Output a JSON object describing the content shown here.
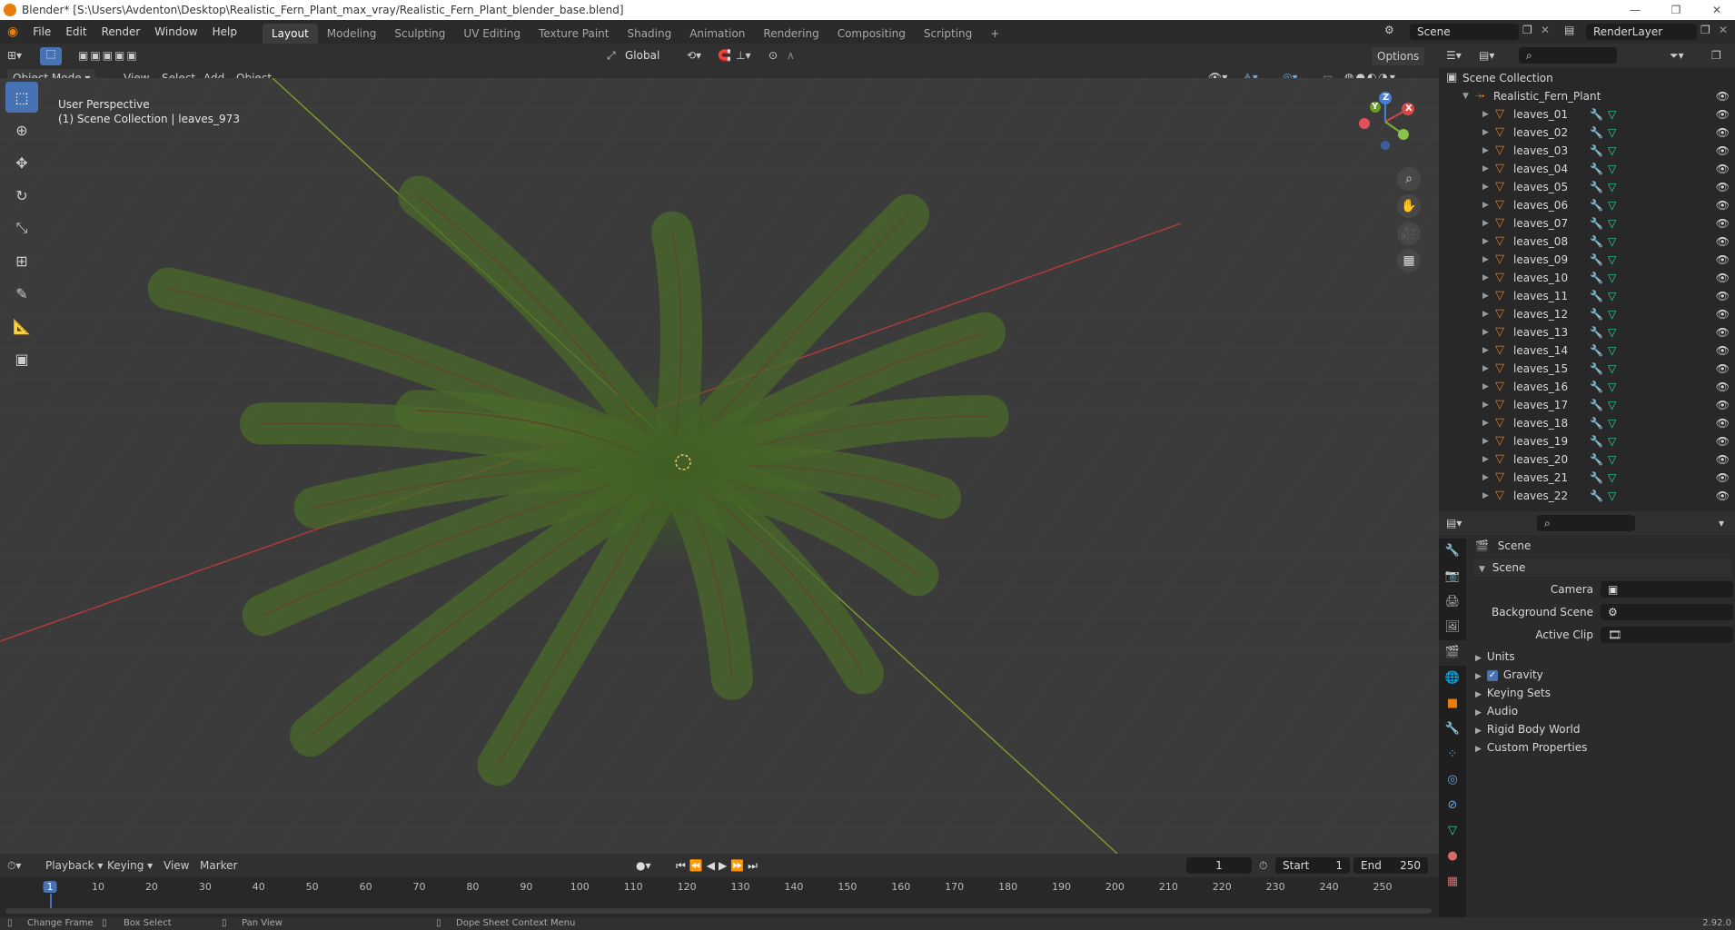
{
  "window": {
    "title": "Blender* [S:\\Users\\Avdenton\\Desktop\\Realistic_Fern_Plant_max_vray/Realistic_Fern_Plant_blender_base.blend]"
  },
  "menus": [
    "File",
    "Edit",
    "Render",
    "Window",
    "Help"
  ],
  "workspaces": [
    "Layout",
    "Modeling",
    "Sculpting",
    "UV Editing",
    "Texture Paint",
    "Shading",
    "Animation",
    "Rendering",
    "Compositing",
    "Scripting"
  ],
  "scene_field": "Scene",
  "render_layer_field": "RenderLayer",
  "viewport": {
    "mode": "Object Mode",
    "menus": [
      "View",
      "Select",
      "Add",
      "Object"
    ],
    "transform": "Global",
    "options": "Options",
    "overlay_line1": "User Perspective",
    "overlay_line2": "(1) Scene Collection | leaves_973",
    "gizmo": {
      "x": "X",
      "y": "Y",
      "z": "Z"
    }
  },
  "outliner": {
    "root": "Scene Collection",
    "collection": "Realistic_Fern_Plant",
    "items": [
      "leaves_01",
      "leaves_02",
      "leaves_03",
      "leaves_04",
      "leaves_05",
      "leaves_06",
      "leaves_07",
      "leaves_08",
      "leaves_09",
      "leaves_10",
      "leaves_11",
      "leaves_12",
      "leaves_13",
      "leaves_14",
      "leaves_15",
      "leaves_16",
      "leaves_17",
      "leaves_18",
      "leaves_19",
      "leaves_20",
      "leaves_21",
      "leaves_22"
    ]
  },
  "properties": {
    "header": "Scene",
    "panel": "Scene",
    "camera_label": "Camera",
    "background_label": "Background Scene",
    "clip_label": "Active Clip",
    "sections": [
      "Units",
      "Gravity",
      "Keying Sets",
      "Audio",
      "Rigid Body World",
      "Custom Properties"
    ],
    "gravity_checked": true
  },
  "timeline": {
    "menus": [
      "Playback",
      "Keying",
      "View",
      "Marker"
    ],
    "current_frame": "1",
    "start_label": "Start",
    "start": "1",
    "end_label": "End",
    "end": "250",
    "ticks": [
      "1",
      "10",
      "20",
      "30",
      "40",
      "50",
      "60",
      "70",
      "80",
      "90",
      "100",
      "110",
      "120",
      "130",
      "140",
      "150",
      "160",
      "170",
      "180",
      "190",
      "200",
      "210",
      "220",
      "230",
      "240",
      "250"
    ]
  },
  "statusbar": {
    "items": [
      "Change Frame",
      "Box Select",
      "Pan View",
      "Dope Sheet Context Menu"
    ],
    "version": "2.92.0"
  },
  "colors": {
    "accent": "#4772b3",
    "object_orange": "#e87d0d",
    "mesh_green": "#2fd69f",
    "fern_green": "#4b6b2a"
  }
}
